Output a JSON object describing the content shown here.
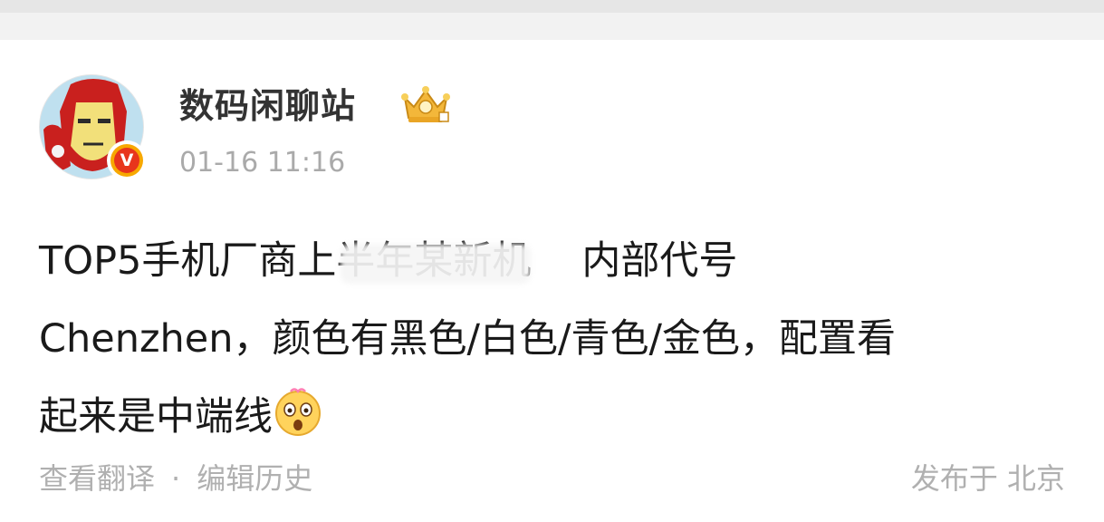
{
  "post": {
    "author": {
      "name": "数码闲聊站",
      "verified_badge": "V",
      "level_icon": "crown-level-icon"
    },
    "timestamp": "01-16 11:16",
    "content_lines": [
      "TOP5手机厂商上半年某新机",
      "内部代号",
      "Chenzhen，颜色有黑色/白色/青色/金色，配置看",
      "起来是中端线"
    ],
    "footer": {
      "translate_label": "查看翻译",
      "separator": "·",
      "edit_history_label": "编辑历史",
      "location_label": "发布于 北京"
    }
  },
  "colors": {
    "text_primary": "#1a1a1a",
    "text_secondary": "#aaaaaa",
    "verified_red": "#e8351c",
    "badge_gold": "#f7a800"
  }
}
